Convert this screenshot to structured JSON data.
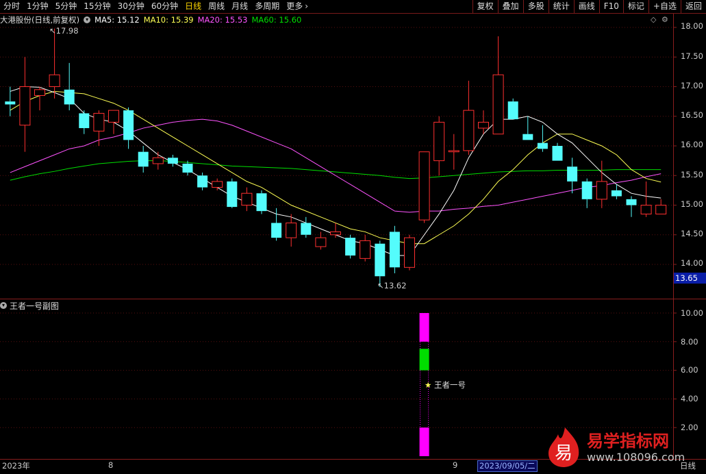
{
  "toolbar": {
    "periods": [
      "分时",
      "1分钟",
      "5分钟",
      "15分钟",
      "30分钟",
      "60分钟",
      "日线",
      "周线",
      "月线",
      "多周期",
      "更多"
    ],
    "active_period": "日线",
    "actions": [
      "复权",
      "叠加",
      "多股",
      "统计",
      "画线",
      "F10",
      "标记",
      "+自选",
      "返回"
    ]
  },
  "stock": {
    "title": "大港股份(日线,前复权)",
    "ma5_label": "MA5: 15.12",
    "ma10_label": "MA10: 15.39",
    "ma20_label": "MA20: 15.53",
    "ma60_label": "MA60: 15.60",
    "high_marker": "17.98",
    "low_marker": "13.62",
    "current_price": "13.65"
  },
  "colors": {
    "up": "#ff3030",
    "down": "#54fcfc",
    "ma5": "#ffffff",
    "ma10": "#ffff54",
    "ma20": "#ff54ff",
    "ma60": "#00e000",
    "signal_magenta": "#ff00ff",
    "signal_green": "#00dd00",
    "axis_red": "#8a1e1e"
  },
  "price_axis": [
    "18.00",
    "17.50",
    "17.00",
    "16.50",
    "16.00",
    "15.50",
    "15.00",
    "14.50",
    "14.00"
  ],
  "indicator_panel": {
    "title": "王者一号副图",
    "axis": [
      "10.00",
      "8.00",
      "6.00",
      "4.00",
      "2.00"
    ],
    "signal_label": "王者一号"
  },
  "bottom": {
    "year_label": "2023年",
    "month_8": "8",
    "month_9": "9",
    "selected_date": "2023/09/05/二",
    "period": "日线"
  },
  "watermark": {
    "title": "易学指标网",
    "url": "www.108096.com",
    "logo_char": "易"
  },
  "chart_data": {
    "type": "candlestick",
    "ylim": [
      13.4,
      18.15
    ],
    "candles": [
      {
        "o": 16.75,
        "h": 17.0,
        "l": 16.5,
        "c": 16.7
      },
      {
        "o": 16.35,
        "h": 17.5,
        "l": 15.9,
        "c": 17.0
      },
      {
        "o": 16.85,
        "h": 17.0,
        "l": 16.6,
        "c": 16.95
      },
      {
        "o": 17.0,
        "h": 17.98,
        "l": 16.8,
        "c": 17.2
      },
      {
        "o": 16.95,
        "h": 17.4,
        "l": 16.6,
        "c": 16.7
      },
      {
        "o": 16.55,
        "h": 16.6,
        "l": 16.2,
        "c": 16.3
      },
      {
        "o": 16.25,
        "h": 16.6,
        "l": 16.0,
        "c": 16.55
      },
      {
        "o": 16.4,
        "h": 16.6,
        "l": 16.2,
        "c": 16.6
      },
      {
        "o": 16.6,
        "h": 16.65,
        "l": 15.95,
        "c": 16.1
      },
      {
        "o": 15.9,
        "h": 16.0,
        "l": 15.55,
        "c": 15.65
      },
      {
        "o": 15.7,
        "h": 15.9,
        "l": 15.6,
        "c": 15.8
      },
      {
        "o": 15.8,
        "h": 15.85,
        "l": 15.65,
        "c": 15.7
      },
      {
        "o": 15.7,
        "h": 15.75,
        "l": 15.5,
        "c": 15.55
      },
      {
        "o": 15.5,
        "h": 15.55,
        "l": 15.25,
        "c": 15.3
      },
      {
        "o": 15.3,
        "h": 15.45,
        "l": 15.25,
        "c": 15.4
      },
      {
        "o": 15.4,
        "h": 15.45,
        "l": 14.95,
        "c": 14.97
      },
      {
        "o": 15.0,
        "h": 15.3,
        "l": 14.9,
        "c": 15.2
      },
      {
        "o": 15.2,
        "h": 15.25,
        "l": 14.85,
        "c": 14.9
      },
      {
        "o": 14.7,
        "h": 14.95,
        "l": 14.4,
        "c": 14.45
      },
      {
        "o": 14.45,
        "h": 14.85,
        "l": 14.3,
        "c": 14.7
      },
      {
        "o": 14.7,
        "h": 14.8,
        "l": 14.45,
        "c": 14.5
      },
      {
        "o": 14.3,
        "h": 14.55,
        "l": 14.25,
        "c": 14.45
      },
      {
        "o": 14.5,
        "h": 14.7,
        "l": 14.45,
        "c": 14.55
      },
      {
        "o": 14.45,
        "h": 14.5,
        "l": 14.1,
        "c": 14.15
      },
      {
        "o": 14.1,
        "h": 14.5,
        "l": 14.05,
        "c": 14.4
      },
      {
        "o": 14.35,
        "h": 14.4,
        "l": 13.62,
        "c": 13.8
      },
      {
        "o": 14.55,
        "h": 14.65,
        "l": 13.85,
        "c": 13.95
      },
      {
        "o": 13.95,
        "h": 14.5,
        "l": 13.9,
        "c": 14.45
      },
      {
        "o": 14.75,
        "h": 15.9,
        "l": 14.7,
        "c": 15.9
      },
      {
        "o": 15.75,
        "h": 16.5,
        "l": 15.5,
        "c": 16.4
      },
      {
        "o": 15.9,
        "h": 16.2,
        "l": 15.6,
        "c": 15.92
      },
      {
        "o": 15.92,
        "h": 17.1,
        "l": 15.85,
        "c": 16.6
      },
      {
        "o": 16.3,
        "h": 16.6,
        "l": 16.2,
        "c": 16.4
      },
      {
        "o": 16.2,
        "h": 17.85,
        "l": 16.2,
        "c": 17.2
      },
      {
        "o": 16.75,
        "h": 16.8,
        "l": 16.45,
        "c": 16.45
      },
      {
        "o": 16.2,
        "h": 16.5,
        "l": 16.1,
        "c": 16.1
      },
      {
        "o": 16.05,
        "h": 16.35,
        "l": 15.9,
        "c": 15.95
      },
      {
        "o": 16.0,
        "h": 16.05,
        "l": 15.75,
        "c": 15.75
      },
      {
        "o": 15.65,
        "h": 15.8,
        "l": 15.2,
        "c": 15.4
      },
      {
        "o": 15.4,
        "h": 15.45,
        "l": 14.95,
        "c": 15.1
      },
      {
        "o": 15.1,
        "h": 15.75,
        "l": 14.95,
        "c": 15.4
      },
      {
        "o": 15.25,
        "h": 15.35,
        "l": 15.1,
        "c": 15.15
      },
      {
        "o": 15.1,
        "h": 15.15,
        "l": 14.8,
        "c": 15.0
      },
      {
        "o": 14.85,
        "h": 15.4,
        "l": 14.8,
        "c": 15.0
      },
      {
        "o": 14.85,
        "h": 15.1,
        "l": 14.85,
        "c": 15.0
      }
    ],
    "ma5": [
      16.92,
      17.0,
      16.99,
      16.9,
      16.8,
      16.55,
      16.45,
      16.4,
      16.25,
      16.05,
      15.85,
      15.72,
      15.6,
      15.45,
      15.3,
      15.15,
      15.05,
      14.95,
      14.85,
      14.8,
      14.7,
      14.6,
      14.5,
      14.4,
      14.35,
      14.25,
      14.15,
      14.15,
      14.5,
      14.85,
      15.25,
      15.8,
      16.2,
      16.45,
      16.45,
      16.5,
      16.4,
      16.2,
      16.05,
      15.8,
      15.55,
      15.35,
      15.2,
      15.15,
      15.12
    ],
    "ma10": [
      16.6,
      16.75,
      16.85,
      16.92,
      16.9,
      16.88,
      16.8,
      16.72,
      16.6,
      16.45,
      16.3,
      16.15,
      16.0,
      15.85,
      15.7,
      15.55,
      15.4,
      15.3,
      15.15,
      15.0,
      14.9,
      14.8,
      14.7,
      14.6,
      14.55,
      14.45,
      14.4,
      14.35,
      14.35,
      14.5,
      14.65,
      14.85,
      15.1,
      15.4,
      15.6,
      15.85,
      16.05,
      16.2,
      16.2,
      16.1,
      16.0,
      15.85,
      15.6,
      15.45,
      15.39
    ],
    "ma20": [
      15.55,
      15.65,
      15.75,
      15.85,
      15.95,
      16.0,
      16.1,
      16.15,
      16.22,
      16.3,
      16.35,
      16.4,
      16.43,
      16.45,
      16.42,
      16.35,
      16.25,
      16.15,
      16.05,
      15.95,
      15.8,
      15.65,
      15.5,
      15.35,
      15.2,
      15.05,
      14.9,
      14.88,
      14.9,
      14.9,
      14.93,
      14.95,
      14.98,
      15.0,
      15.05,
      15.1,
      15.15,
      15.2,
      15.25,
      15.3,
      15.33,
      15.38,
      15.42,
      15.48,
      15.53
    ],
    "ma60": [
      15.42,
      15.48,
      15.53,
      15.57,
      15.62,
      15.66,
      15.7,
      15.72,
      15.74,
      15.75,
      15.75,
      15.74,
      15.72,
      15.7,
      15.68,
      15.66,
      15.65,
      15.64,
      15.63,
      15.62,
      15.6,
      15.58,
      15.56,
      15.54,
      15.52,
      15.5,
      15.47,
      15.45,
      15.46,
      15.48,
      15.5,
      15.52,
      15.54,
      15.56,
      15.57,
      15.58,
      15.58,
      15.59,
      15.59,
      15.59,
      15.59,
      15.6,
      15.6,
      15.6,
      15.6
    ],
    "indicator": {
      "candle_index": 28,
      "bars": [
        {
          "from": 8.0,
          "to": 10.0,
          "color": "magenta"
        },
        {
          "from": 6.0,
          "to": 7.5,
          "color": "green"
        },
        {
          "from": 0.0,
          "to": 2.0,
          "color": "magenta"
        }
      ],
      "ylim": [
        0,
        10.5
      ]
    }
  }
}
